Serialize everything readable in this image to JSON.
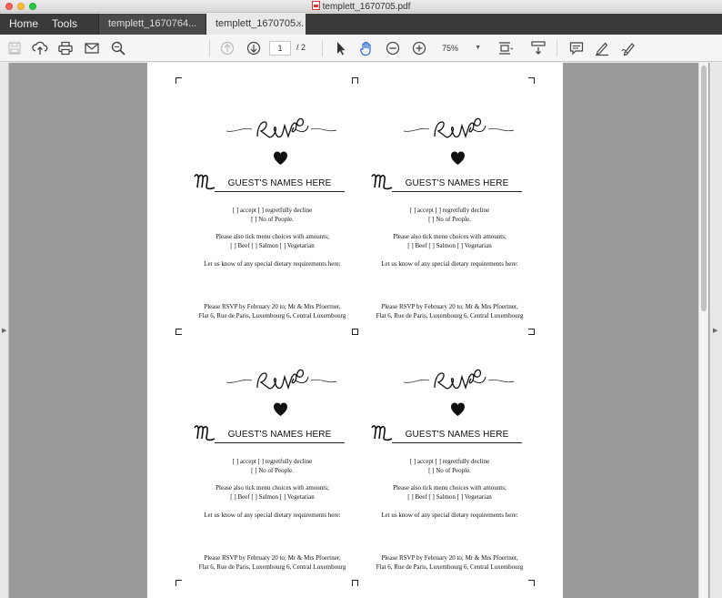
{
  "window": {
    "title": "templett_1670705.pdf"
  },
  "nav": {
    "home": "Home",
    "tools": "Tools"
  },
  "tabs": [
    {
      "label": "templett_1670764..."
    },
    {
      "label": "templett_1670705...",
      "close": "×"
    }
  ],
  "toolbar": {
    "page_current": "1",
    "page_total": "/ 2",
    "zoom": "75%",
    "icons": [
      "save-icon",
      "upload-icon",
      "print-icon",
      "email-icon",
      "search-zoom-icon",
      "prev-page-icon",
      "next-page-icon",
      "select-arrow-icon",
      "hand-tool-icon",
      "zoom-out-icon",
      "zoom-in-icon",
      "fit-page-icon",
      "scroll-mode-icon",
      "comment-icon",
      "highlight-icon",
      "sign-icon"
    ]
  },
  "document": {
    "cards": [
      {
        "guest": "GUEST'S NAMES HERE",
        "line1": "[     ] accept     [     ]  regretfully decline",
        "line2": "[     ] No of People.",
        "line3": "Please also tick menu choices with amounts;",
        "line4": "[   ] Beef   [   ]  Salmon   [   ] Vegetarian",
        "line5": "Let us know of any special  dietary requirements here:",
        "line6": "Please RSVP by February 20 to; Mr & Mrs Pfoertner,",
        "line7": "Flat 6, Rue de Paris, Luxembourg 6, Central Luxembourg"
      },
      {
        "guest": "GUEST'S NAMES HERE",
        "line1": "[     ] accept     [     ]  regretfully decline",
        "line2": "[     ] No of People.",
        "line3": "Please also tick menu choices with amounts;",
        "line4": "[   ] Beef   [   ]  Salmon   [   ] Vegetarian",
        "line5": "Let us know of any special  dietary requirements here:",
        "line6": "Please RSVP by February 20 to; Mr & Mrs Pfoertner,",
        "line7": "Flat 6, Rue de Paris, Luxembourg 6, Central Luxembourg"
      },
      {
        "guest": "GUEST'S NAMES HERE",
        "line1": "[     ] accept     [     ]  regretfully decline",
        "line2": "[     ] No of People.",
        "line3": "Please also tick menu choices with amounts;",
        "line4": "[   ] Beef   [   ]  Salmon   [   ] Vegetarian",
        "line5": "Let us know of any special  dietary requirements here:",
        "line6": "Please RSVP by February 20 to; Mr & Mrs Pfoertner,",
        "line7": "Flat 6, Rue de Paris, Luxembourg 6, Central Luxembourg"
      },
      {
        "guest": "GUEST'S NAMES HERE",
        "line1": "[     ] accept     [     ]  regretfully decline",
        "line2": "[     ] No of People.",
        "line3": "Please also tick menu choices with amounts;",
        "line4": "[   ] Beef   [   ]  Salmon   [   ] Vegetarian",
        "line5": "Let us know of any special  dietary requirements here:",
        "line6": "Please RSVP by February 20 to; Mr & Mrs Pfoertner,",
        "line7": "Flat 6, Rue de Paris, Luxembourg 6, Central Luxembourg"
      }
    ]
  },
  "colors": {
    "tab_bar": "#3a3a3a",
    "workspace": "#9a9a9a",
    "hand_tool_accent": "#2a6ad6"
  }
}
